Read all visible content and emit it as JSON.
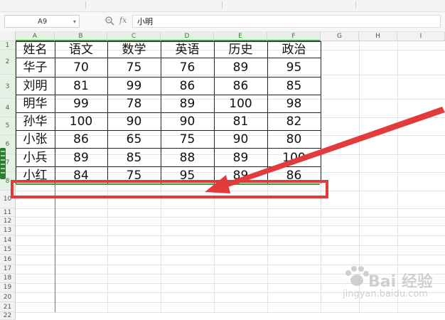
{
  "formula_bar": {
    "name_box": "A9",
    "fx_label": "fx",
    "formula": "小明"
  },
  "columns": [
    "A",
    "B",
    "C",
    "D",
    "E",
    "F",
    "G",
    "H",
    "I"
  ],
  "rows": [
    "1",
    "2",
    "3",
    "4",
    "5",
    "6",
    "7",
    "8",
    "10",
    "11",
    "12",
    "13",
    "14",
    "15",
    "16",
    "17",
    "18",
    "19",
    "20",
    "21",
    "22"
  ],
  "table": {
    "headers": [
      "姓名",
      "语文",
      "数学",
      "英语",
      "历史",
      "政治"
    ],
    "body": [
      [
        "华子",
        "70",
        "75",
        "76",
        "89",
        "95"
      ],
      [
        "刘明",
        "81",
        "99",
        "86",
        "86",
        "85"
      ],
      [
        "明华",
        "99",
        "78",
        "89",
        "100",
        "98"
      ],
      [
        "孙华",
        "100",
        "90",
        "90",
        "81",
        "82"
      ],
      [
        "小张",
        "86",
        "65",
        "75",
        "90",
        "80"
      ],
      [
        "小兵",
        "89",
        "85",
        "88",
        "89",
        "100"
      ],
      [
        "小红",
        "84",
        "75",
        "95",
        "89",
        "86"
      ]
    ]
  },
  "watermark": {
    "text": "Bai 经验",
    "sub": "jingyan.baidu.com"
  },
  "colors": {
    "selection_green": "#3aa13a",
    "annotation_red": "#e23b3b"
  }
}
